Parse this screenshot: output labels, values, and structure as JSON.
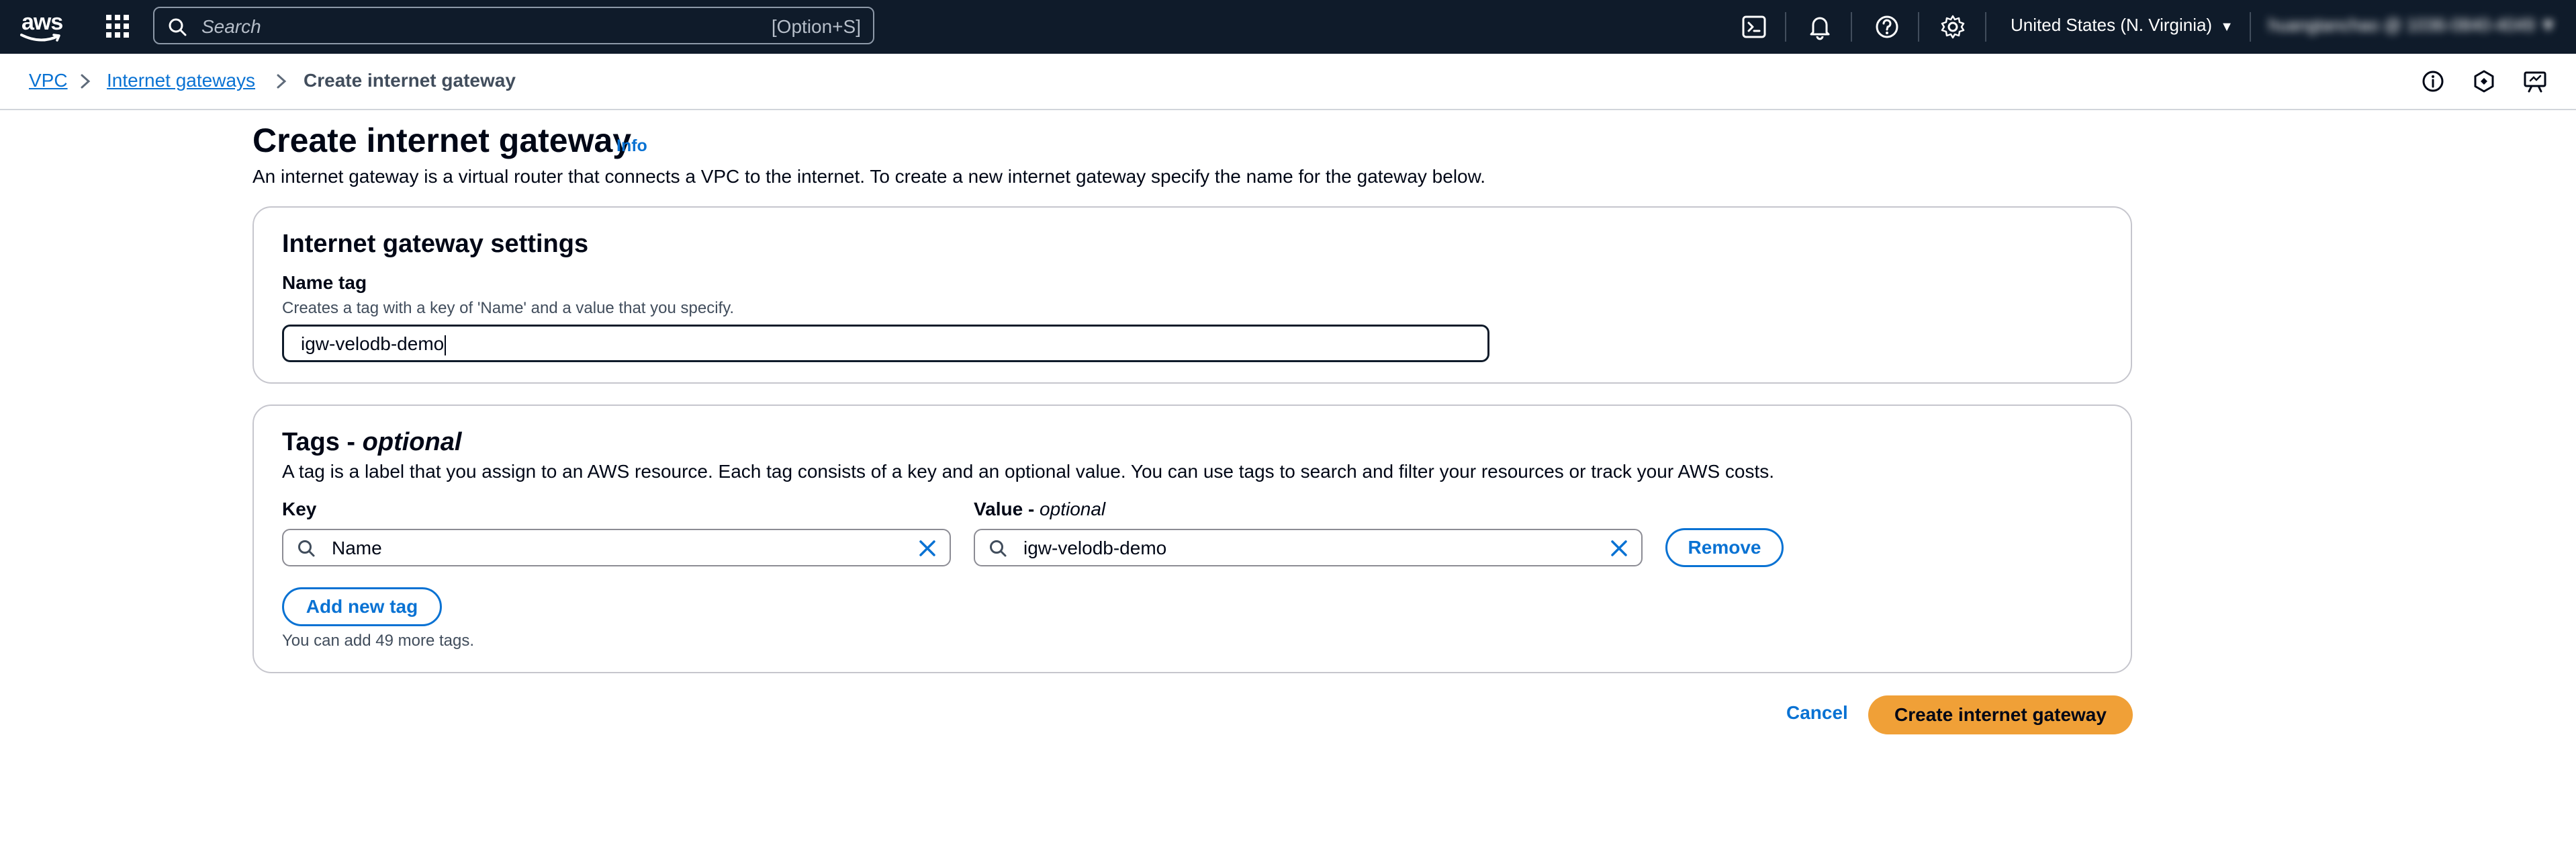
{
  "topnav": {
    "logo_text": "aws",
    "search_placeholder": "Search",
    "search_shortcut": "[Option+S]",
    "region": "United States (N. Virginia)",
    "account": "huangtanchao @ 1036-0840-4049"
  },
  "breadcrumb": {
    "items": [
      {
        "label": "VPC"
      },
      {
        "label": "Internet gateways"
      },
      {
        "label": "Create internet gateway"
      }
    ]
  },
  "page": {
    "title": "Create internet gateway",
    "info": "Info",
    "description": "An internet gateway is a virtual router that connects a VPC to the internet. To create a new internet gateway specify the name for the gateway below."
  },
  "settings": {
    "title": "Internet gateway settings",
    "name_tag_label": "Name tag",
    "name_tag_desc": "Creates a tag with a key of 'Name' and a value that you specify.",
    "name_tag_value": "igw-velodb-demo"
  },
  "tags": {
    "title": "Tags - ",
    "title_optional": "optional",
    "description": "A tag is a label that you assign to an AWS resource. Each tag consists of a key and an optional value. You can use tags to search and filter your resources or track your AWS costs.",
    "key_label": "Key",
    "value_label": "Value - ",
    "value_label_optional": "optional",
    "rows": [
      {
        "key": "Name",
        "value": "igw-velodb-demo",
        "remove": "Remove"
      }
    ],
    "add_button": "Add new tag",
    "hint": "You can add 49 more tags."
  },
  "actions": {
    "cancel": "Cancel",
    "submit": "Create internet gateway"
  },
  "colors": {
    "nav_bg": "#0f1b2a",
    "link": "#0972d3",
    "primary_button": "#f0a037",
    "text": "#000716"
  }
}
